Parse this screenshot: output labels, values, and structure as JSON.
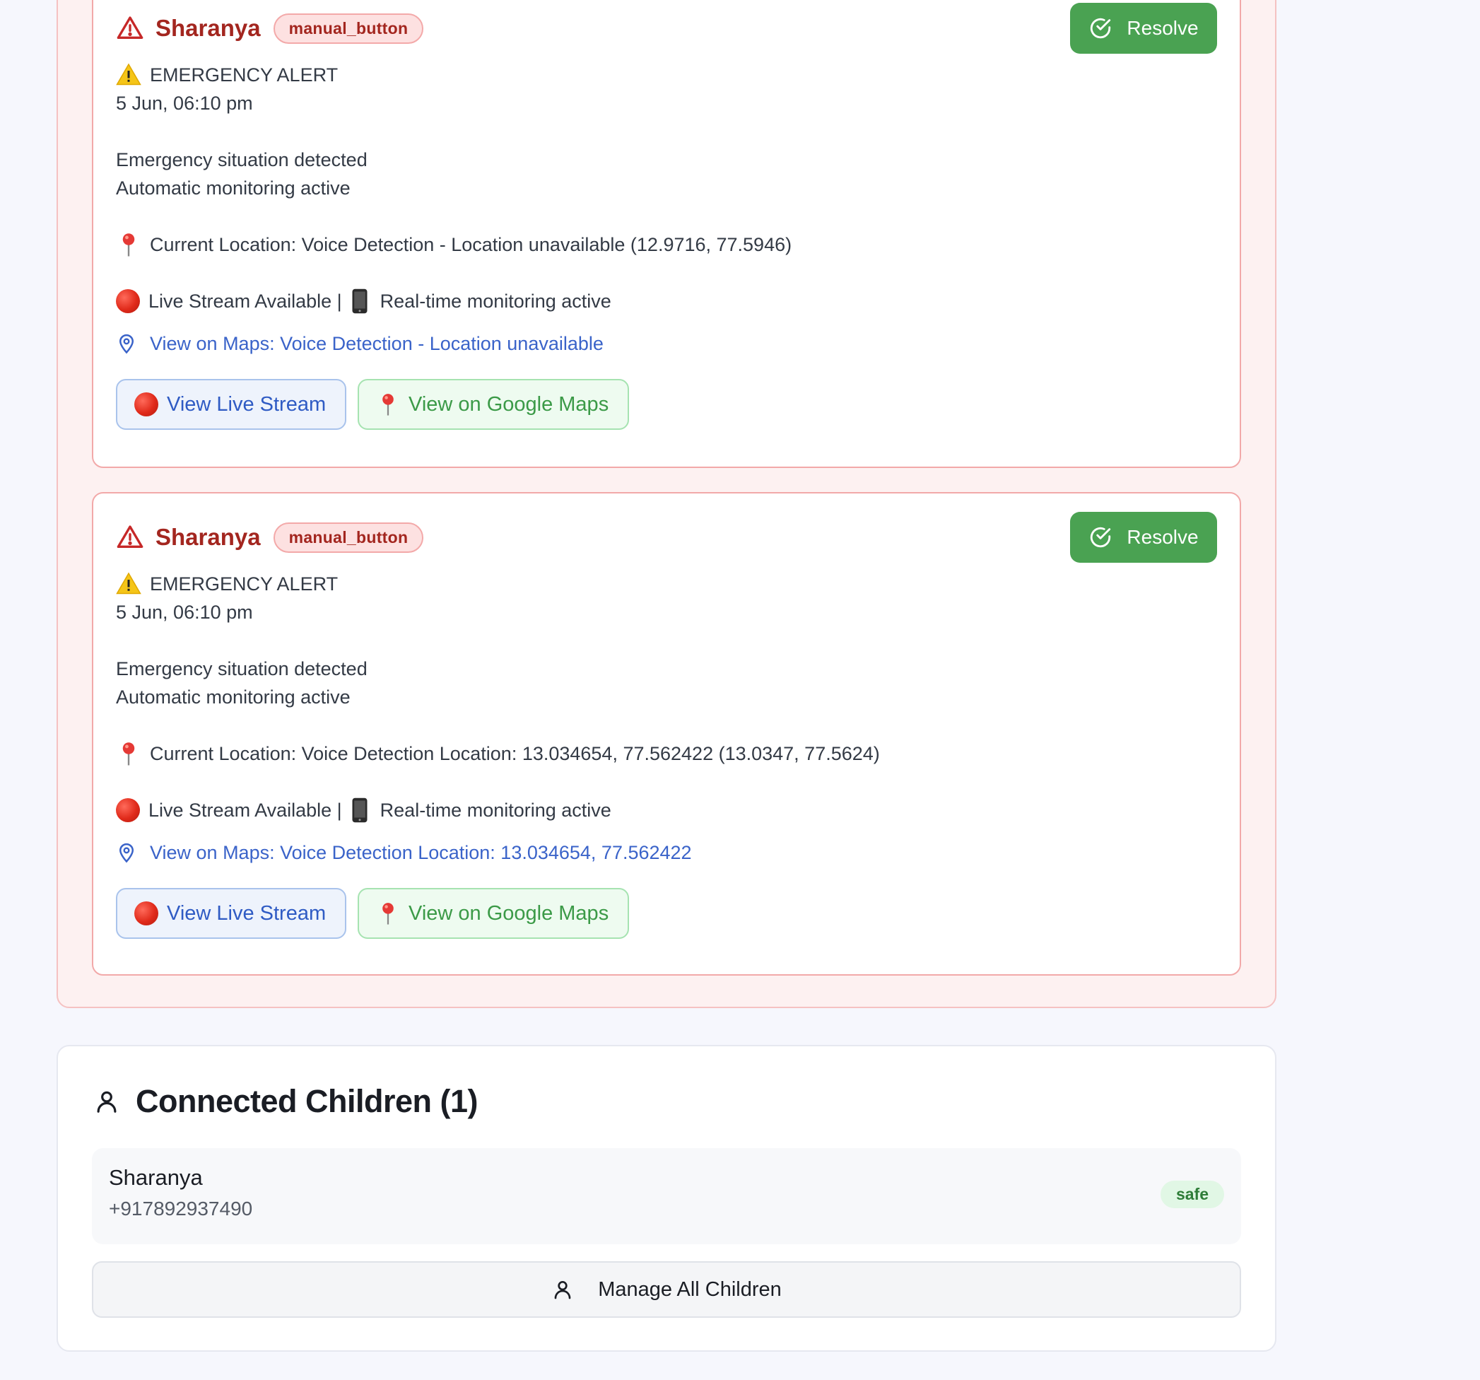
{
  "alerts": [
    {
      "child_name": "Sharanya",
      "trigger": "manual_button",
      "resolve_label": "Resolve",
      "title": "EMERGENCY ALERT",
      "time": "5 Jun, 06:10 pm",
      "line1": "Emergency situation detected",
      "line2": "Automatic monitoring active",
      "location": "Current Location: Voice Detection - Location unavailable (12.9716, 77.5946)",
      "stream_status": "Live Stream Available |",
      "monitoring": "Real-time monitoring active",
      "map_link": "View on Maps: Voice Detection - Location unavailable",
      "live_stream_label": "View Live Stream",
      "google_maps_label": "View on Google Maps"
    },
    {
      "child_name": "Sharanya",
      "trigger": "manual_button",
      "resolve_label": "Resolve",
      "title": "EMERGENCY ALERT",
      "time": "5 Jun, 06:10 pm",
      "line1": "Emergency situation detected",
      "line2": "Automatic monitoring active",
      "location": "Current Location: Voice Detection Location: 13.034654, 77.562422 (13.0347, 77.5624)",
      "stream_status": "Live Stream Available |",
      "monitoring": "Real-time monitoring active",
      "map_link": "View on Maps: Voice Detection Location: 13.034654, 77.562422",
      "live_stream_label": "View Live Stream",
      "google_maps_label": "View on Google Maps"
    }
  ],
  "connected_children": {
    "title": "Connected Children (1)",
    "children": [
      {
        "name": "Sharanya",
        "phone": "+917892937490",
        "status": "safe"
      }
    ],
    "manage_label": "Manage All Children"
  },
  "colors": {
    "danger": "#a3261f",
    "resolve": "#4aa252",
    "link": "#3a63c9",
    "safe_badge": "#e1f7e5"
  }
}
